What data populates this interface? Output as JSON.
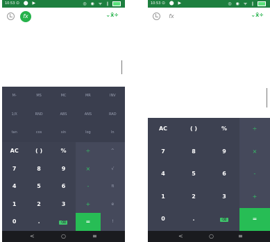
{
  "status": {
    "time": "10:53",
    "left_icons": "⊙ ⬤ ▶",
    "right_icons": "◎ ◉ ᯤ ∥"
  },
  "icons": {
    "history": "history-icon",
    "formula": "fx-icon",
    "mode": "mode-toggle-icon"
  },
  "mode_label": "⌄x̄÷",
  "fx_glyph": "fx",
  "sci_keys": [
    [
      "M-",
      "MS",
      "MC",
      "MR",
      "INV"
    ],
    [
      "1/X",
      "RND",
      "ABS",
      "ANS",
      "RAD"
    ],
    [
      "tan",
      "cos",
      "sin",
      "log",
      "ln"
    ]
  ],
  "left_keys": [
    [
      "AC",
      "( )",
      "%",
      "÷",
      "^"
    ],
    [
      "7",
      "8",
      "9",
      "×",
      "√"
    ],
    [
      "4",
      "5",
      "6",
      "-",
      "π"
    ],
    [
      "1",
      "2",
      "3",
      "+",
      "e"
    ],
    [
      "0",
      ".",
      "⌫",
      "=",
      "!"
    ]
  ],
  "right_keys": [
    [
      "AC",
      "( )",
      "%",
      "÷"
    ],
    [
      "7",
      "8",
      "9",
      "×"
    ],
    [
      "4",
      "5",
      "6",
      "-"
    ],
    [
      "1",
      "2",
      "3",
      "+"
    ],
    [
      "0",
      ".",
      "⌫",
      "="
    ]
  ],
  "navbar": {
    "back": "<",
    "home": "○",
    "recents": "≡"
  },
  "colors": {
    "accent": "#26b24b",
    "keypad": "#3d4151",
    "status": "#1d7f3f"
  }
}
